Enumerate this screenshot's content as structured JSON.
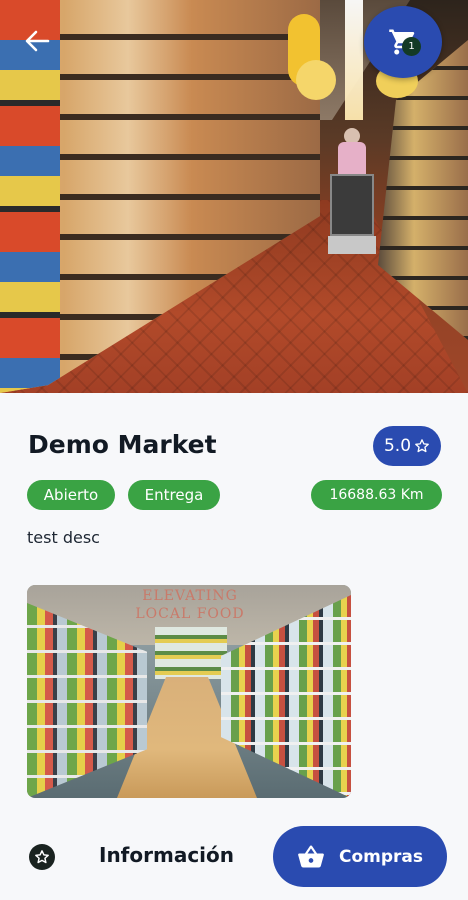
{
  "store": {
    "name": "Demo Market",
    "rating": "5.0",
    "status_tag": "Abierto",
    "delivery_tag": "Entrega",
    "distance": "16688.63 Km",
    "description": "test desc"
  },
  "header": {
    "cart_count": "1",
    "back_icon": "arrow-left-icon",
    "cart_icon": "shopping-cart-icon"
  },
  "gallery": {
    "wall_text": "ELEVATING LOCAL FOOD"
  },
  "bottom_bar": {
    "info_label": "Información",
    "shop_label": "Compras",
    "star_icon": "star-icon",
    "basket_icon": "basket-icon"
  },
  "colors": {
    "primary": "#2a4bb0",
    "tag_green": "#3aa344",
    "background": "#f7f8fa"
  }
}
